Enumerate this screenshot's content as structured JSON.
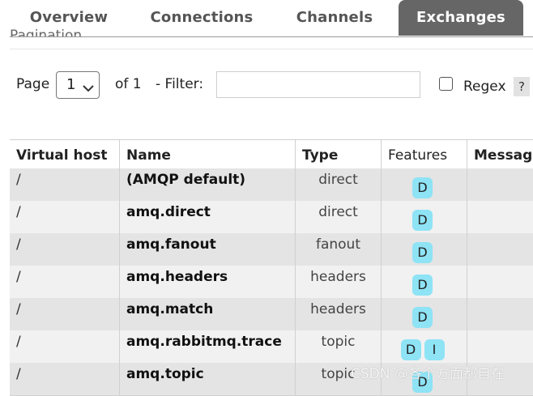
{
  "tabs": [
    {
      "label": "Overview",
      "active": false
    },
    {
      "label": "Connections",
      "active": false
    },
    {
      "label": "Channels",
      "active": false
    },
    {
      "label": "Exchanges",
      "active": true
    }
  ],
  "section_title": "Pagination",
  "pagination": {
    "page_label": "Page",
    "page_value": "1",
    "of_label": "of 1",
    "filter_label": "- Filter:",
    "filter_value": "",
    "regex_label": "Regex",
    "regex_checked": false,
    "help_label": "?"
  },
  "table": {
    "columns": [
      "Virtual host",
      "Name",
      "Type",
      "Features",
      "Messag"
    ],
    "rows": [
      {
        "vhost": "/",
        "name": "(AMQP default)",
        "type": "direct",
        "features": [
          "D"
        ]
      },
      {
        "vhost": "/",
        "name": "amq.direct",
        "type": "direct",
        "features": [
          "D"
        ]
      },
      {
        "vhost": "/",
        "name": "amq.fanout",
        "type": "fanout",
        "features": [
          "D"
        ]
      },
      {
        "vhost": "/",
        "name": "amq.headers",
        "type": "headers",
        "features": [
          "D"
        ]
      },
      {
        "vhost": "/",
        "name": "amq.match",
        "type": "headers",
        "features": [
          "D"
        ]
      },
      {
        "vhost": "/",
        "name": "amq.rabbitmq.trace",
        "type": "topic",
        "features": [
          "D",
          "I"
        ]
      },
      {
        "vhost": "/",
        "name": "amq.topic",
        "type": "topic",
        "features": [
          "D"
        ]
      }
    ]
  },
  "colors": {
    "active_tab": "#666666",
    "feature_badge": "#8ee3f5"
  },
  "watermark": "CSDN @各个方面都自在"
}
